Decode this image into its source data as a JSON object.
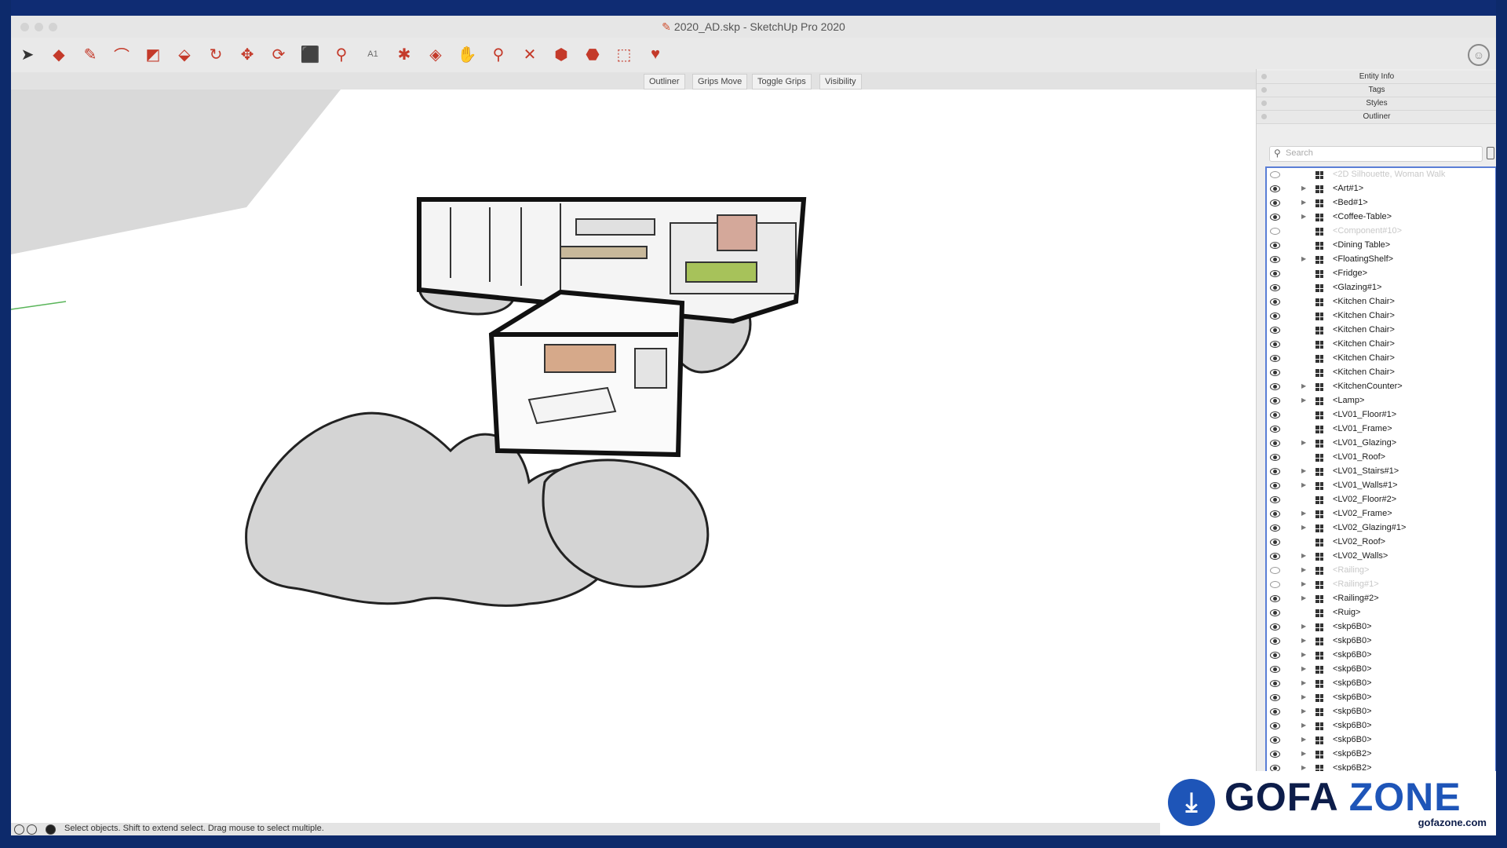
{
  "window": {
    "title": "2020_AD.skp - SketchUp Pro 2020"
  },
  "toolbar": {
    "tools": [
      {
        "icon": "select-arrow-icon",
        "glyph": "➤"
      },
      {
        "icon": "eraser-icon",
        "glyph": "◆"
      },
      {
        "icon": "pencil-line-icon",
        "glyph": "✎"
      },
      {
        "icon": "arc-icon",
        "glyph": "⌒"
      },
      {
        "icon": "rectangle-icon",
        "glyph": "◩"
      },
      {
        "icon": "push-pull-icon",
        "glyph": "⬙"
      },
      {
        "icon": "offset-icon",
        "glyph": "↻"
      },
      {
        "icon": "move-icon",
        "glyph": "✥"
      },
      {
        "icon": "rotate-icon",
        "glyph": "⟳"
      },
      {
        "icon": "scale-icon",
        "glyph": "⬛"
      },
      {
        "icon": "tape-measure-icon",
        "glyph": "⚲"
      },
      {
        "icon": "text-label-icon",
        "glyph": "A1"
      },
      {
        "icon": "paint-bucket-icon",
        "glyph": "✱"
      },
      {
        "icon": "orbit-icon",
        "glyph": "◈"
      },
      {
        "icon": "pan-hand-icon",
        "glyph": "✋"
      },
      {
        "icon": "zoom-icon",
        "glyph": "⚲"
      },
      {
        "icon": "zoom-extents-icon",
        "glyph": "✕"
      },
      {
        "icon": "warehouse-icon",
        "glyph": "⬢"
      },
      {
        "icon": "extension-warehouse-icon",
        "glyph": "⬣"
      },
      {
        "icon": "send-to-layout-icon",
        "glyph": "⬚"
      },
      {
        "icon": "extension-manager-icon",
        "glyph": "♥"
      }
    ]
  },
  "tabs": [
    "Outliner",
    "Grips Move",
    "Toggle Grips",
    "Visibility"
  ],
  "tray": {
    "panels": [
      "Entity Info",
      "Tags",
      "Styles",
      "Outliner"
    ],
    "search_placeholder": "Search",
    "items": [
      {
        "name": "<2D Silhouette, Woman Walk",
        "expandable": false,
        "hidden": true
      },
      {
        "name": "<Art#1>",
        "expandable": true,
        "hidden": false
      },
      {
        "name": "<Bed#1>",
        "expandable": true,
        "hidden": false
      },
      {
        "name": "<Coffee-Table>",
        "expandable": true,
        "hidden": false
      },
      {
        "name": "<Component#10>",
        "expandable": false,
        "hidden": true
      },
      {
        "name": "<Dining Table>",
        "expandable": false,
        "hidden": false
      },
      {
        "name": "<FloatingShelf>",
        "expandable": true,
        "hidden": false
      },
      {
        "name": "<Fridge>",
        "expandable": false,
        "hidden": false
      },
      {
        "name": "<Glazing#1>",
        "expandable": false,
        "hidden": false
      },
      {
        "name": "<Kitchen Chair>",
        "expandable": false,
        "hidden": false
      },
      {
        "name": "<Kitchen Chair>",
        "expandable": false,
        "hidden": false
      },
      {
        "name": "<Kitchen Chair>",
        "expandable": false,
        "hidden": false
      },
      {
        "name": "<Kitchen Chair>",
        "expandable": false,
        "hidden": false
      },
      {
        "name": "<Kitchen Chair>",
        "expandable": false,
        "hidden": false
      },
      {
        "name": "<Kitchen Chair>",
        "expandable": false,
        "hidden": false
      },
      {
        "name": "<KitchenCounter>",
        "expandable": true,
        "hidden": false
      },
      {
        "name": "<Lamp>",
        "expandable": true,
        "hidden": false
      },
      {
        "name": "<LV01_Floor#1>",
        "expandable": false,
        "hidden": false
      },
      {
        "name": "<LV01_Frame>",
        "expandable": false,
        "hidden": false
      },
      {
        "name": "<LV01_Glazing>",
        "expandable": true,
        "hidden": false
      },
      {
        "name": "<LV01_Roof>",
        "expandable": false,
        "hidden": false
      },
      {
        "name": "<LV01_Stairs#1>",
        "expandable": true,
        "hidden": false
      },
      {
        "name": "<LV01_Walls#1>",
        "expandable": true,
        "hidden": false
      },
      {
        "name": "<LV02_Floor#2>",
        "expandable": false,
        "hidden": false
      },
      {
        "name": "<LV02_Frame>",
        "expandable": true,
        "hidden": false
      },
      {
        "name": "<LV02_Glazing#1>",
        "expandable": true,
        "hidden": false
      },
      {
        "name": "<LV02_Roof>",
        "expandable": false,
        "hidden": false
      },
      {
        "name": "<LV02_Walls>",
        "expandable": true,
        "hidden": false
      },
      {
        "name": "<Railing>",
        "expandable": true,
        "hidden": true
      },
      {
        "name": "<Railing#1>",
        "expandable": true,
        "hidden": true
      },
      {
        "name": "<Railing#2>",
        "expandable": true,
        "hidden": false
      },
      {
        "name": "<Ruig>",
        "expandable": false,
        "hidden": false
      },
      {
        "name": "<skp6B0>",
        "expandable": true,
        "hidden": false
      },
      {
        "name": "<skp6B0>",
        "expandable": true,
        "hidden": false
      },
      {
        "name": "<skp6B0>",
        "expandable": true,
        "hidden": false
      },
      {
        "name": "<skp6B0>",
        "expandable": true,
        "hidden": false
      },
      {
        "name": "<skp6B0>",
        "expandable": true,
        "hidden": false
      },
      {
        "name": "<skp6B0>",
        "expandable": true,
        "hidden": false
      },
      {
        "name": "<skp6B0>",
        "expandable": true,
        "hidden": false
      },
      {
        "name": "<skp6B0>",
        "expandable": true,
        "hidden": false
      },
      {
        "name": "<skp6B0>",
        "expandable": true,
        "hidden": false
      },
      {
        "name": "<skp6B2>",
        "expandable": true,
        "hidden": false
      },
      {
        "name": "<skp6B2>",
        "expandable": true,
        "hidden": false
      }
    ]
  },
  "status": {
    "text": "Select objects. Shift to extend select. Drag mouse to select multiple."
  },
  "watermark": {
    "brand_a": "GOFA",
    "brand_b": "ZONE",
    "url": "gofazone.com"
  },
  "colors": {
    "accent_blue": "#1e55b8",
    "tool_red": "#c43a2a",
    "selection_border": "#5a7ed6"
  }
}
